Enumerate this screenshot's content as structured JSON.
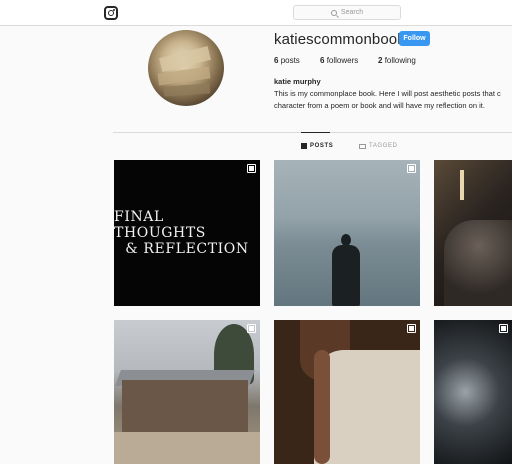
{
  "header": {
    "search_placeholder": "Search"
  },
  "profile": {
    "username": "katiescommonbook",
    "follow_label": "Follow",
    "posts_count": "6",
    "posts_label": "posts",
    "followers_count": "6",
    "followers_label": "followers",
    "following_count": "2",
    "following_label": "following",
    "full_name": "katie murphy",
    "bio_line1": "This is my commonplace book. Here I will post aesthetic posts that c",
    "bio_line2": "character from a poem or book and will have my reflection on it."
  },
  "tabs": {
    "posts_label": "POSTS",
    "tagged_label": "TAGGED"
  },
  "posts": {
    "tile1_line1": "FINAL THOUGHTS",
    "tile1_line2": "& REFLECTION"
  },
  "colors": {
    "follow_button": "#3897f0",
    "background": "#fafafa",
    "border": "#dbdbdb"
  },
  "icons": [
    "instagram-icon",
    "search-icon",
    "grid-icon",
    "tag-icon",
    "multiple-photos-icon"
  ]
}
